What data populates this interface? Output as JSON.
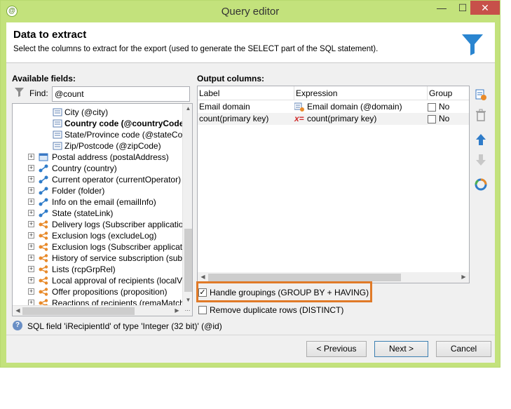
{
  "window": {
    "title": "Query editor"
  },
  "header": {
    "title": "Data to extract",
    "subtitle": "Select the columns to extract for the export (used to generate the SELECT part of the SQL statement)."
  },
  "available": {
    "label": "Available fields:",
    "find_label": "Find:",
    "find_value": "@count",
    "items": [
      {
        "label": "City (@city)",
        "icon": "field-icon",
        "bold": false,
        "expander": false
      },
      {
        "label": "Country code (@countryCode)",
        "icon": "field-icon",
        "bold": true,
        "expander": false
      },
      {
        "label": "State/Province code (@stateCod",
        "icon": "field-icon",
        "bold": false,
        "expander": false
      },
      {
        "label": "Zip/Postcode (@zipCode)",
        "icon": "field-icon",
        "bold": false,
        "expander": false
      },
      {
        "label": "Postal address (postalAddress)",
        "icon": "table-icon",
        "bold": false,
        "expander": true
      },
      {
        "label": "Country (country)",
        "icon": "link-icon",
        "bold": false,
        "expander": true
      },
      {
        "label": "Current operator (currentOperator)",
        "icon": "link-icon",
        "bold": false,
        "expander": true
      },
      {
        "label": "Folder (folder)",
        "icon": "link-icon",
        "bold": false,
        "expander": true
      },
      {
        "label": "Info on the email (emailInfo)",
        "icon": "link-icon",
        "bold": false,
        "expander": true
      },
      {
        "label": "State (stateLink)",
        "icon": "link-icon",
        "bold": false,
        "expander": true
      },
      {
        "label": "Delivery logs (Subscriber applicatio",
        "icon": "collection-icon",
        "bold": false,
        "expander": true
      },
      {
        "label": "Exclusion logs (excludeLog)",
        "icon": "collection-icon",
        "bold": false,
        "expander": true
      },
      {
        "label": "Exclusion logs (Subscriber applicati",
        "icon": "collection-icon",
        "bold": false,
        "expander": true
      },
      {
        "label": "History of service subscription (sub",
        "icon": "collection-icon",
        "bold": false,
        "expander": true
      },
      {
        "label": "Lists (rcpGrpRel)",
        "icon": "collection-icon",
        "bold": false,
        "expander": true
      },
      {
        "label": "Local approval of recipients (localV",
        "icon": "collection-icon",
        "bold": false,
        "expander": true
      },
      {
        "label": "Offer propositions (proposition)",
        "icon": "collection-icon",
        "bold": false,
        "expander": true
      },
      {
        "label": "Reactions of recipients (remaMatch",
        "icon": "collection-icon",
        "bold": false,
        "expander": true
      }
    ]
  },
  "output": {
    "label": "Output columns:",
    "columns": [
      "Label",
      "Expression",
      "Group"
    ],
    "rows": [
      {
        "label": "Email domain",
        "expression": "Email domain (@domain)",
        "expr_icon": "field-link-icon",
        "group": "No"
      },
      {
        "label": "count(primary key)",
        "expression": "count(primary key)",
        "expr_icon": "formula-icon",
        "group": "No"
      }
    ]
  },
  "side_buttons": [
    "add-field-icon",
    "delete-icon",
    "move-up-icon",
    "move-down-icon",
    "distribution-icon"
  ],
  "options": {
    "handle_groupings": {
      "label": "Handle groupings (GROUP BY + HAVING)",
      "checked": true
    },
    "remove_duplicates": {
      "label": "Remove duplicate rows (DISTINCT)",
      "checked": false
    }
  },
  "status": {
    "text": "SQL field 'iRecipientId' of type 'Integer (32 bit)' (@id)"
  },
  "buttons": {
    "previous": "< Previous",
    "next": "Next >",
    "cancel": "Cancel"
  },
  "colors": {
    "accent": "#c3e27c",
    "highlight": "#e07a28",
    "funnel": "#2a85d0"
  }
}
